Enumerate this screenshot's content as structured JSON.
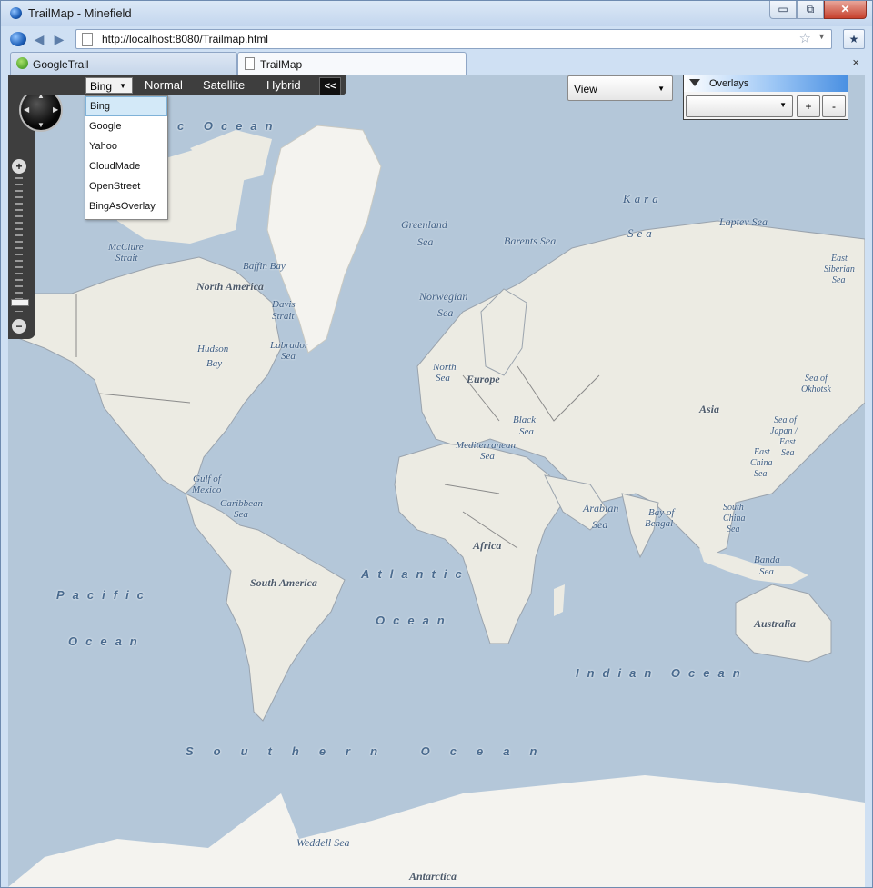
{
  "window": {
    "title": "TrailMap - Minefield",
    "min_label": "▭",
    "max_label": "⧉",
    "close_label": "✕"
  },
  "nav": {
    "url": "http://localhost:8080/Trailmap.html"
  },
  "tabs": [
    {
      "label": "GoogleTrail",
      "active": false
    },
    {
      "label": "TrailMap",
      "active": true
    }
  ],
  "tab_close_label": "×",
  "map_toolbar": {
    "provider_selected": "Bing",
    "provider_options": [
      "Bing",
      "Google",
      "Yahoo",
      "CloudMade",
      "OpenStreet",
      "BingAsOverlay"
    ],
    "map_types": [
      "Normal",
      "Satellite",
      "Hybrid"
    ],
    "collapse_label": "<<"
  },
  "view_select": {
    "value": "View"
  },
  "overlays": {
    "title": "Overlays",
    "add_label": "+",
    "remove_label": "-"
  },
  "map_labels": {
    "pacific": "Pacific",
    "pacific_ocean": "Ocean",
    "atlantic": "Atlantic",
    "atlantic_ocean": "Ocean",
    "indian_ocean": "Indian Ocean",
    "southern_ocean": "Southern Ocean",
    "arctic_ocean": "c    Ocean",
    "kara_sea": "Kara",
    "kara_sea2": "Sea",
    "laptev_sea": "Laptev Sea",
    "greenland_sea": "Greenland",
    "greenland_sea2": "Sea",
    "barents_sea": "Barents Sea",
    "east_siberian_sea": "East",
    "east_siberian_sea2": "Siberian",
    "east_siberian_sea3": "Sea",
    "mcclure_strait": "McClure",
    "mcclure_strait2": "Strait",
    "baffin_bay": "Baffin Bay",
    "north_america": "North America",
    "davis_strait": "Davis",
    "davis_strait2": "Strait",
    "norwegian_sea": "Norwegian",
    "norwegian_sea2": "Sea",
    "hudson_bay": "Hudson",
    "hudson_bay2": "Bay",
    "labrador_sea": "Labrador",
    "labrador_sea2": "Sea",
    "north_sea": "North",
    "north_sea2": "Sea",
    "europe": "Europe",
    "sea_of_okhotsk": "Sea of",
    "sea_of_okhotsk2": "Okhotsk",
    "asia": "Asia",
    "black_sea": "Black",
    "black_sea2": "Sea",
    "mediterranean_sea": "Mediterranean",
    "mediterranean_sea2": "Sea",
    "sea_of_japan": "Sea of",
    "sea_of_japan2": "Japan /",
    "sea_of_japan3": "East",
    "sea_of_japan4": "Sea",
    "east_china_sea": "East",
    "east_china_sea2": "China",
    "east_china_sea3": "Sea",
    "gulf_of_mexico": "Gulf of",
    "gulf_of_mexico2": "Mexico",
    "caribbean_sea": "Caribbean",
    "caribbean_sea2": "Sea",
    "arabian_sea": "Arabian",
    "arabian_sea2": "Sea",
    "bay_of_bengal": "Bay of",
    "bay_of_bengal2": "Bengal",
    "south_china_sea": "South",
    "south_china_sea2": "China",
    "south_china_sea3": "Sea",
    "africa": "Africa",
    "south_america": "South America",
    "banda_sea": "Banda",
    "banda_sea2": "Sea",
    "australia": "Australia",
    "weddell_sea": "Weddell Sea",
    "antarctica": "Antarctica"
  },
  "icons": {
    "app": "firefox-globe-icon",
    "back": "back-arrow-icon",
    "forward": "forward-arrow-icon",
    "bookmark": "star-icon"
  }
}
